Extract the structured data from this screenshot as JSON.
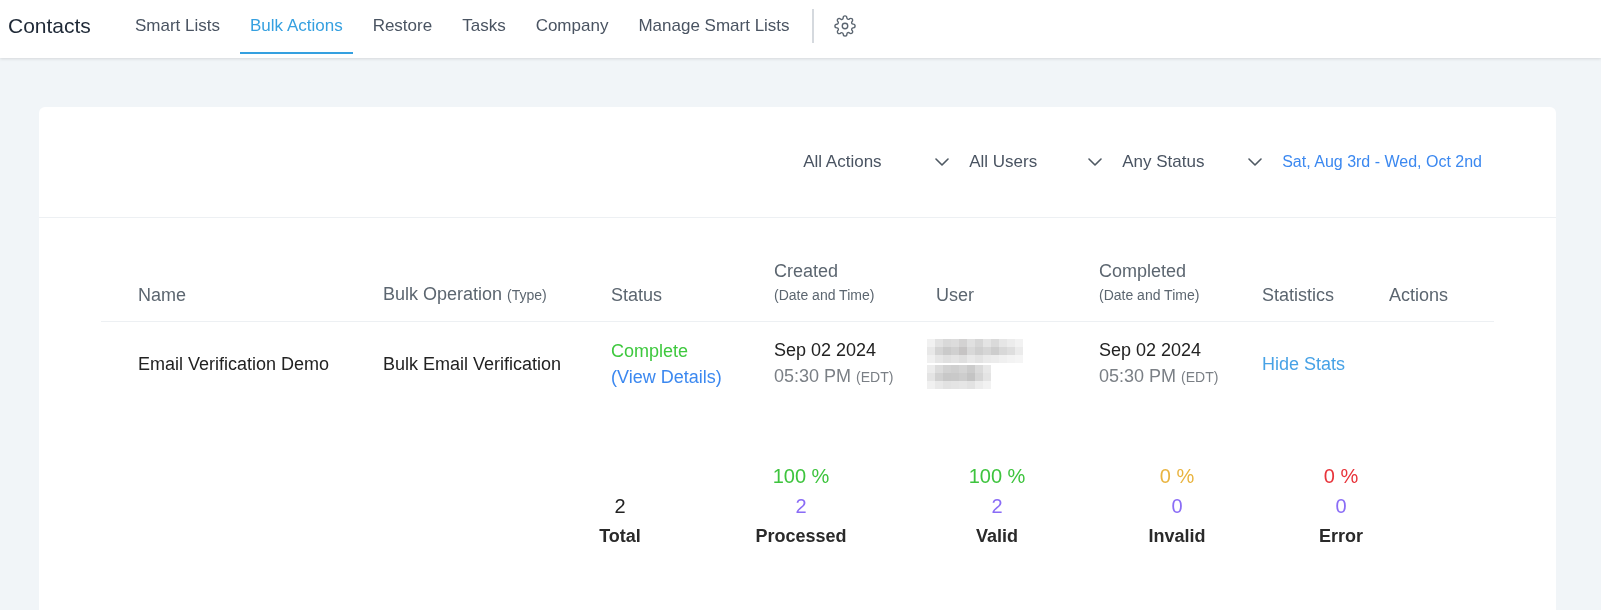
{
  "nav": {
    "title": "Contacts",
    "tabs": [
      {
        "label": "Smart Lists",
        "selected": false
      },
      {
        "label": "Bulk Actions",
        "selected": true
      },
      {
        "label": "Restore",
        "selected": false
      },
      {
        "label": "Tasks",
        "selected": false
      },
      {
        "label": "Company",
        "selected": false
      },
      {
        "label": "Manage Smart Lists",
        "selected": false
      }
    ]
  },
  "filters": [
    {
      "kind": "dropdown",
      "label": "All Actions"
    },
    {
      "kind": "dropdown",
      "label": "All Users"
    },
    {
      "kind": "dropdown",
      "label": "Any Status"
    },
    {
      "kind": "date-range",
      "label": "Sat, Aug 3rd - Wed, Oct 2nd"
    }
  ],
  "table": {
    "columns": [
      {
        "label": "Name"
      },
      {
        "label": "Bulk Operation",
        "note": "(Type)"
      },
      {
        "label": "Status"
      },
      {
        "label": "Created",
        "sub": "(Date and Time)"
      },
      {
        "label": "User"
      },
      {
        "label": "Completed",
        "sub": "(Date and Time)"
      },
      {
        "label": "Statistics"
      },
      {
        "label": "Actions"
      }
    ],
    "rows": [
      {
        "name": "Email Verification Demo",
        "operation": "Bulk Email Verification",
        "status": "Complete",
        "details_link": "(View Details)",
        "created": {
          "date": "Sep 02 2024",
          "time": "05:30 PM",
          "zone": "(EDT)"
        },
        "completed": {
          "date": "Sep 02 2024",
          "time": "05:30 PM",
          "zone": "(EDT)"
        },
        "stats_link": "Hide Stats",
        "stats": [
          {
            "kind": "total",
            "count": "2",
            "label": "Total"
          },
          {
            "kind": "ratio",
            "percent": "100 %",
            "color": "#3ec43e",
            "count": "2",
            "label": "Processed"
          },
          {
            "kind": "ratio",
            "percent": "100 %",
            "color": "#3ec43e",
            "count": "2",
            "label": "Valid"
          },
          {
            "kind": "ratio",
            "percent": "0 %",
            "color": "#e9b440",
            "count": "0",
            "label": "Invalid"
          },
          {
            "kind": "ratio",
            "percent": "0 %",
            "color": "#e8343b",
            "count": "0",
            "label": "Error"
          }
        ]
      }
    ]
  }
}
